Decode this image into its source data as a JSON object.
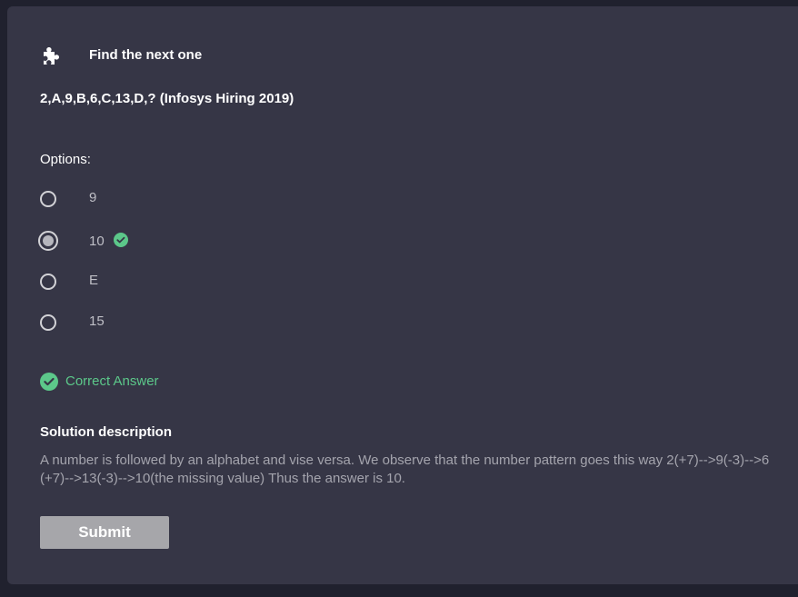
{
  "header": {
    "icon": "puzzle-piece-icon",
    "title": "Find the next one"
  },
  "question": {
    "text": "2,A,9,B,6,C,13,D,? (Infosys Hiring 2019)"
  },
  "options": {
    "label": "Options:",
    "items": [
      {
        "label": "9",
        "selected": false,
        "correct": false
      },
      {
        "label": "10",
        "selected": true,
        "correct": true
      },
      {
        "label": "E",
        "selected": false,
        "correct": false
      },
      {
        "label": "15",
        "selected": false,
        "correct": false
      }
    ]
  },
  "result": {
    "icon": "check-circle-icon",
    "text": "Correct Answer",
    "color": "#5cc88a"
  },
  "solution": {
    "title": "Solution description",
    "text": "A number is followed by an alphabet and vise versa. We observe that the number pattern goes this way 2(+7)-->9(-3)-->6(+7)-->13(-3)-->10(the missing value) Thus the answer is 10."
  },
  "submit": {
    "label": "Submit"
  },
  "colors": {
    "background": "#20212e",
    "card": "#363646",
    "accent_green": "#5cc88a",
    "button": "#a6a6aa"
  }
}
